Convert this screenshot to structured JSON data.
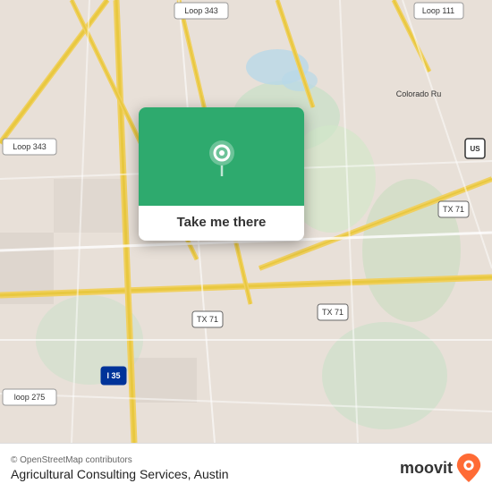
{
  "map": {
    "background_color": "#e8e0d8",
    "center_lat": 30.2,
    "center_lng": -97.78
  },
  "popup": {
    "button_label": "Take me there",
    "pin_icon": "location-pin-icon",
    "background_color": "#2eaa6e"
  },
  "bottom_bar": {
    "credit_text": "© OpenStreetMap contributors",
    "location_name": "Agricultural Consulting Services, Austin",
    "moovit_label": "moovit"
  },
  "road_labels": {
    "loop343_top": "Loop 343",
    "loop343_left": "Loop 343",
    "loop111": "Loop 111",
    "colorado": "Colorado Ru",
    "tx71_center": "TX 71",
    "tx71_right": "TX 71",
    "tx71_bottom": "TX 71",
    "i35": "I 35",
    "loop275": "loop 275",
    "us": "US"
  }
}
